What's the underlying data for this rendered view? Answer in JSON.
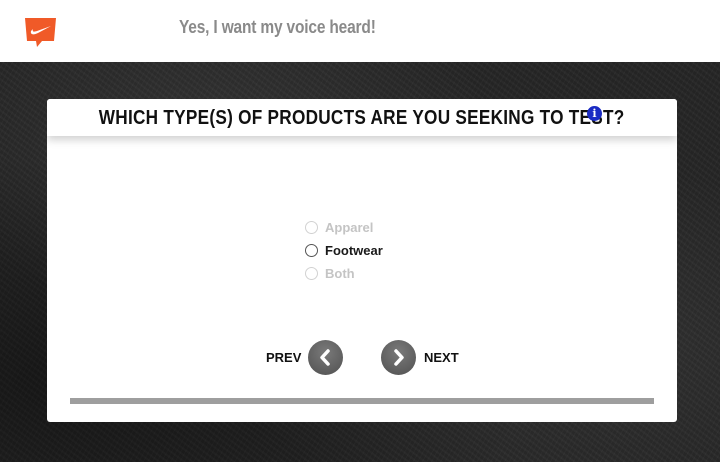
{
  "header": {
    "tagline": "Yes, I want my voice heard!",
    "logo_icon": "nike-swoosh-speech-bubble-icon",
    "logo_color": "#f05a28"
  },
  "survey": {
    "question": "WHICH TYPE(S) OF PRODUCTS ARE YOU SEEKING TO TEST?",
    "info_glyph": "i",
    "options": [
      {
        "label": "Apparel",
        "disabled": true
      },
      {
        "label": "Footwear",
        "disabled": false
      },
      {
        "label": "Both",
        "disabled": true
      }
    ],
    "prev_label": "PREV",
    "next_label": "NEXT",
    "progress_fraction": 1.0
  },
  "colors": {
    "info_icon": "#1a2bc4",
    "nav_button": "#606060",
    "progress": "#9e9e9e"
  }
}
